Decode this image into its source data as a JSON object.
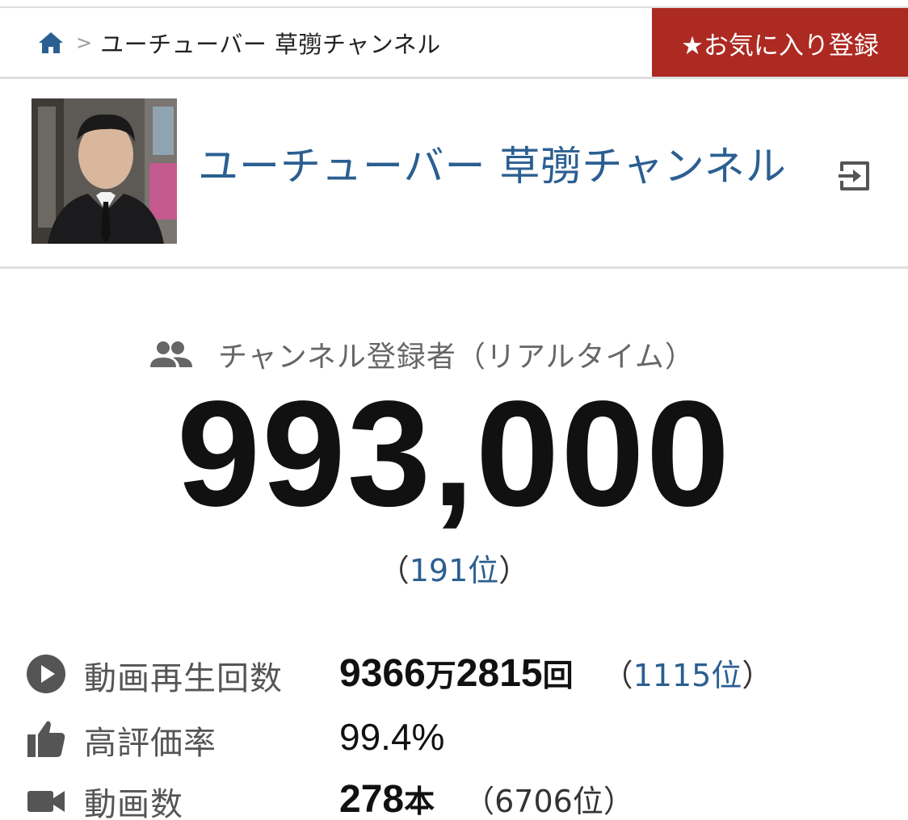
{
  "topbar": {
    "breadcrumb_current": "ユーチューバー 草彅チャンネル",
    "breadcrumb_separator": ">",
    "favorite_button": "★お気に入り登録"
  },
  "channel": {
    "name": "ユーチューバー 草彅チャンネル"
  },
  "subscribers": {
    "label": "チャンネル登録者（リアルタイム）",
    "count": "993,000",
    "rank_open": "（",
    "rank": "191位",
    "rank_close": "）"
  },
  "stats": {
    "views": {
      "label": "動画再生回数",
      "value_a": "9366",
      "unit_a": "万",
      "value_b": "2815",
      "unit_b": "回",
      "rank_open": "（",
      "rank": "1115位",
      "rank_close": "）"
    },
    "rating": {
      "label": "高評価率",
      "value": "99.4%"
    },
    "videos": {
      "label": "動画数",
      "value": "278",
      "unit": "本",
      "rank": "（6706位）"
    }
  },
  "colors": {
    "accent_link": "#2b5f91",
    "favorite_bg": "#ad2a22",
    "icon_gray": "#555555"
  },
  "icons": [
    "home-icon",
    "exit-icon",
    "people-icon",
    "play-icon",
    "thumbs-up-icon",
    "video-camera-icon"
  ]
}
